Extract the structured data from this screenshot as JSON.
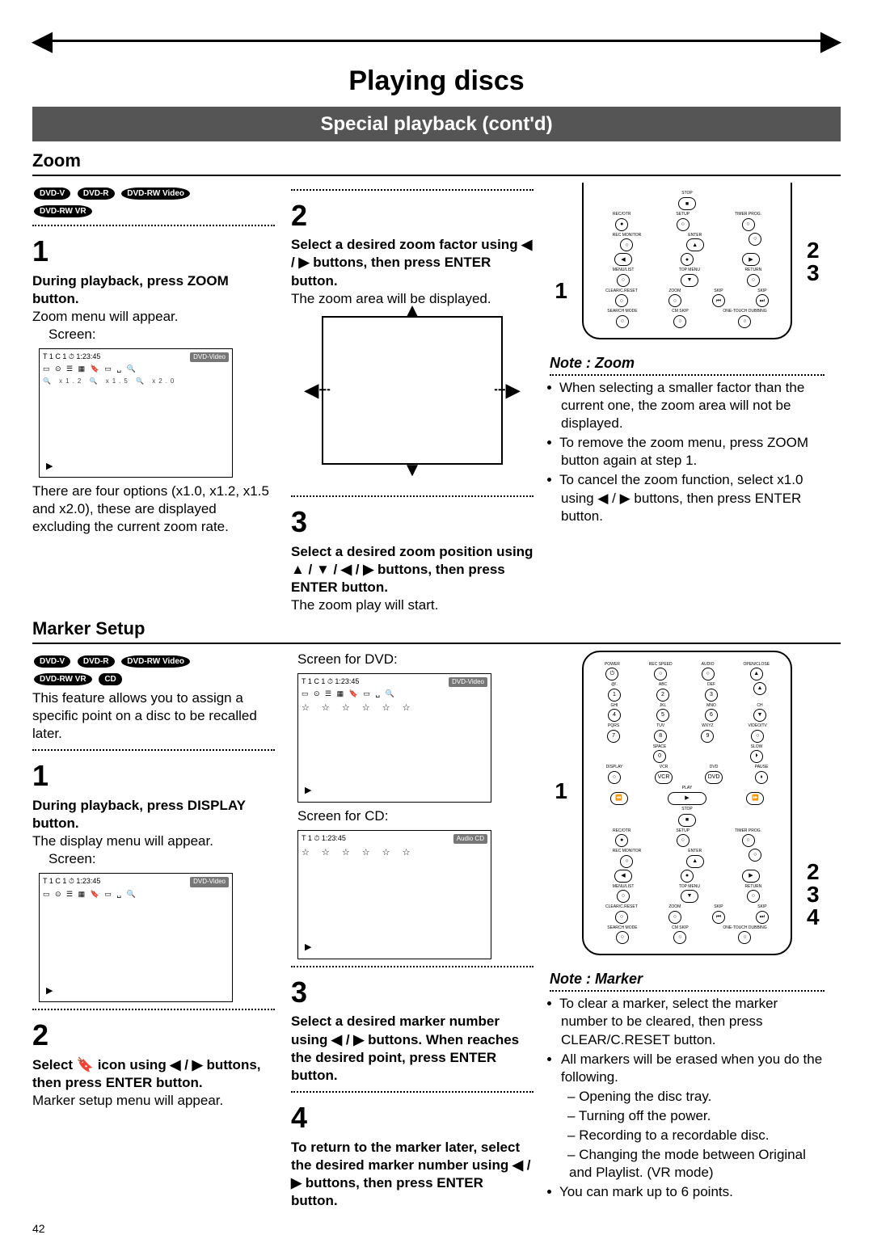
{
  "page": {
    "title": "Playing discs",
    "subtitle": "Special playback (cont'd)",
    "number": "42"
  },
  "zoom": {
    "heading": "Zoom",
    "badges": [
      "DVD-V",
      "DVD-R",
      "DVD-RW Video",
      "DVD-RW VR"
    ],
    "step1": {
      "num": "1",
      "instr": "During playback, press ZOOM button.",
      "desc": "Zoom menu will appear.",
      "screen_label": "Screen:",
      "screen_time": "T  1  C   1  ⏱  1:23:45",
      "screen_badge": "DVD-Video",
      "screen_opts": "🔍 x1.2   🔍 x1.5   🔍 x2.0",
      "after": "There are four options (x1.0, x1.2, x1.5 and x2.0), these are displayed excluding the current zoom rate."
    },
    "step2": {
      "num": "2",
      "instr": "Select a desired zoom factor using ◀ / ▶ buttons, then press ENTER button.",
      "desc": "The zoom area will be displayed."
    },
    "step3": {
      "num": "3",
      "instr": "Select a desired zoom position using ▲ / ▼ / ◀ / ▶ buttons, then press ENTER button.",
      "desc": "The zoom play will start."
    },
    "note": {
      "title": "Note : Zoom",
      "items": [
        "When selecting a smaller factor than the current one, the zoom area will not be displayed.",
        "To remove the zoom menu, press ZOOM button again at step 1.",
        "To cancel the zoom function, select x1.0 using ◀ / ▶ buttons, then press ENTER button."
      ]
    },
    "callouts": {
      "left": "1",
      "right": [
        "2",
        "3"
      ]
    }
  },
  "marker": {
    "heading": "Marker Setup",
    "badges": [
      "DVD-V",
      "DVD-R",
      "DVD-RW Video",
      "DVD-RW VR",
      "CD"
    ],
    "intro": "This feature allows you to assign a specific point on a disc to be recalled later.",
    "step1": {
      "num": "1",
      "instr": "During playback, press DISPLAY button.",
      "desc": "The display menu will appear.",
      "screen_label": "Screen:",
      "screen_time": "T  1  C   1  ⏱  1:23:45",
      "screen_badge": "DVD-Video"
    },
    "step2": {
      "num": "2",
      "instr": "Select  🔖  icon using ◀ / ▶ buttons, then press ENTER button.",
      "desc": "Marker setup menu will appear."
    },
    "col2": {
      "dvd_label": "Screen for DVD:",
      "dvd_time": "T  1  C   1  ⏱  1:23:45",
      "dvd_badge": "DVD-Video",
      "cd_label": "Screen for CD:",
      "cd_time": "T  1  ⏱  1:23:45",
      "cd_badge": "Audio CD"
    },
    "step3": {
      "num": "3",
      "instr": "Select a desired marker number using ◀ / ▶ buttons. When reaches the desired point, press ENTER button."
    },
    "step4": {
      "num": "4",
      "instr": "To return to the marker later, select the desired marker number using ◀ / ▶ buttons, then press ENTER button."
    },
    "note": {
      "title": "Note : Marker",
      "item1": "To clear a marker, select the marker number to be cleared, then press CLEAR/C.RESET button.",
      "item2": "All markers will be erased when you do the following.",
      "sub": [
        "Opening the disc tray.",
        "Turning off the power.",
        "Recording to a recordable disc.",
        "Changing the mode between Original and Playlist. (VR mode)"
      ],
      "item3": "You can mark up to 6 points."
    },
    "callouts": {
      "left": "1",
      "right": [
        "2",
        "3",
        "4"
      ]
    }
  },
  "remote_labels": {
    "stop": "STOP",
    "rec_otr": "REC/OTR",
    "setup": "SETUP",
    "timer_prog": "TIMER PROG.",
    "rec_monitor": "REC MONITOR",
    "enter": "ENTER",
    "menu_list": "MENU/LIST",
    "top_menu": "TOP MENU",
    "return": "RETURN",
    "clear": "CLEAR/C.RESET",
    "zoom": "ZOOM",
    "skip1": "SKIP",
    "skip2": "SKIP",
    "search": "SEARCH MODE",
    "cm_skip": "CM SKIP",
    "dubbing": "ONE-TOUCH DUBBING",
    "power": "POWER",
    "rec_speed": "REC SPEED",
    "audio": "AUDIO",
    "open": "OPEN/CLOSE",
    "ch": "CH",
    "video": "VIDEO/TV",
    "space": "SPACE",
    "slow": "SLOW",
    "display": "DISPLAY",
    "vcr": "VCR",
    "dvd": "DVD",
    "pause": "PAUSE",
    "play": "PLAY"
  }
}
